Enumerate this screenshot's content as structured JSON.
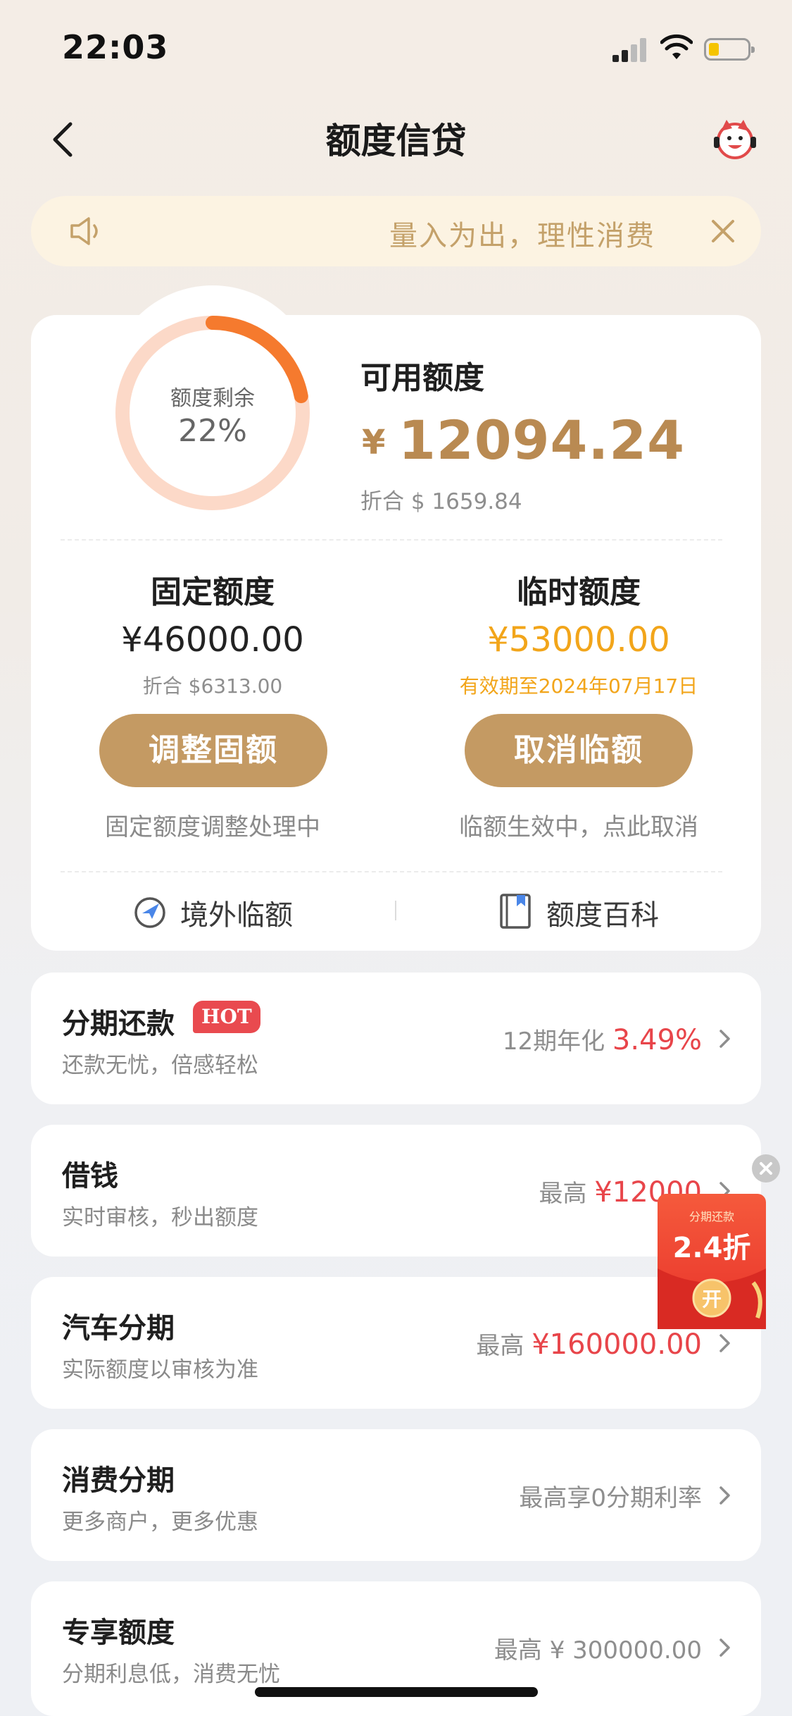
{
  "status_bar": {
    "time": "22:03"
  },
  "nav": {
    "title": "额度信贷"
  },
  "notice": {
    "text": "量入为出，理性消费"
  },
  "quota": {
    "ring_label": "额度剩余",
    "ring_percent": "22%",
    "ring_value": 0.22,
    "available_title": "可用额度",
    "available_currency": "¥",
    "available_amount": "12094.24",
    "available_usd": "折合 $ 1659.84"
  },
  "fixed": {
    "title": "固定额度",
    "amount": "¥46000.00",
    "usd": "折合 $6313.00",
    "button": "调整固额",
    "note": "固定额度调整处理中"
  },
  "temp": {
    "title": "临时额度",
    "amount": "¥53000.00",
    "validity": "有效期至2024年07月17日",
    "button": "取消临额",
    "note": "临额生效中，点此取消"
  },
  "links": {
    "overseas": "境外临额",
    "encyclopedia": "额度百科"
  },
  "list": [
    {
      "title": "分期还款",
      "badge": "HOT",
      "subtitle": "还款无忧，倍感轻松",
      "right_prefix": "12期年化 ",
      "right_value": "3.49%"
    },
    {
      "title": "借钱",
      "subtitle": "实时审核，秒出额度",
      "right_prefix": "最高 ",
      "right_value": "¥12000"
    },
    {
      "title": "汽车分期",
      "subtitle": "实际额度以审核为准",
      "right_prefix": "最高 ",
      "right_value": "¥160000.00"
    },
    {
      "title": "消费分期",
      "subtitle": "更多商户，更多优惠",
      "right_prefix": "最高享0分期利率",
      "right_value": ""
    },
    {
      "title": "专享额度",
      "subtitle": "分期利息低，消费无忧",
      "right_prefix": "最高 ¥ 300000.00",
      "right_value": ""
    }
  ],
  "promo": {
    "top": "分期还款",
    "discount": "2.4折",
    "button": "开"
  },
  "colors": {
    "accent": "#c49a63",
    "gold_text": "#b98a52",
    "red": "#e8454a",
    "ring_orange": "#f57a2e",
    "ring_track": "#fcd9c8",
    "temp_amount": "#f2a51a"
  }
}
